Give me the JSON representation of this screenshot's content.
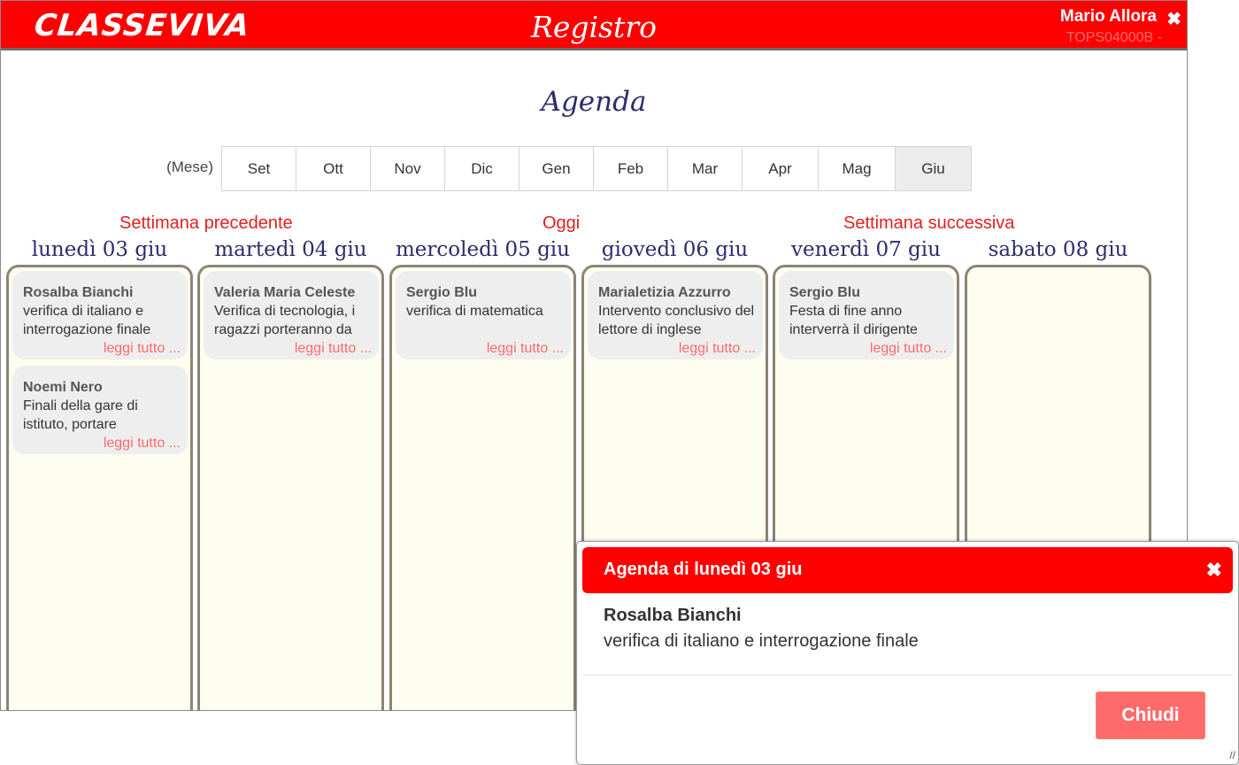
{
  "header": {
    "logo": "CLASSEVIVA",
    "title": "Registro",
    "user_name": "Mario Allora",
    "user_code": "TOPS04000B -",
    "close_glyph": "✖"
  },
  "page": {
    "title": "Agenda"
  },
  "months": {
    "label": "(Mese)",
    "items": [
      "Set",
      "Ott",
      "Nov",
      "Dic",
      "Gen",
      "Feb",
      "Mar",
      "Apr",
      "Mag",
      "Giu"
    ],
    "selected": "Giu"
  },
  "week_nav": {
    "prev": "Settimana precedente",
    "today": "Oggi",
    "next": "Settimana successiva"
  },
  "days": [
    {
      "header": "lunedì 03 giu",
      "events": [
        {
          "author": "Rosalba Bianchi",
          "text": "verifica di italiano e interrogazione finale",
          "more": "leggi tutto ..."
        },
        {
          "author": "Noemi Nero",
          "text": "Finali della gare di istituto, portare",
          "more": "leggi tutto ..."
        }
      ]
    },
    {
      "header": "martedì 04 giu",
      "events": [
        {
          "author": "Valeria Maria Celeste",
          "text": "Verifica di tecnologia, i ragazzi porteranno da",
          "more": "leggi tutto ..."
        }
      ]
    },
    {
      "header": "mercoledì 05 giu",
      "events": [
        {
          "author": "Sergio Blu",
          "text": "verifica di matematica",
          "more": "leggi tutto ..."
        }
      ]
    },
    {
      "header": "giovedì 06 giu",
      "events": [
        {
          "author": "Marialetizia Azzurro",
          "text": "Intervento conclusivo del lettore di inglese",
          "more": "leggi tutto ..."
        }
      ]
    },
    {
      "header": "venerdì 07 giu",
      "events": [
        {
          "author": "Sergio Blu",
          "text": "Festa di fine anno interverrà il dirigente",
          "more": "leggi tutto ..."
        }
      ]
    },
    {
      "header": "sabato 08 giu",
      "events": []
    }
  ],
  "dialog": {
    "title": "Agenda di lunedì 03 giu",
    "close_glyph": "✖",
    "author": "Rosalba Bianchi",
    "text": "verifica di italiano e interrogazione finale",
    "button": "Chiudi"
  },
  "colors": {
    "brand_red": "#ff0000",
    "link_red": "#ff6b6b",
    "heading_navy": "#2c2d6b",
    "column_bg": "#fefef0"
  }
}
